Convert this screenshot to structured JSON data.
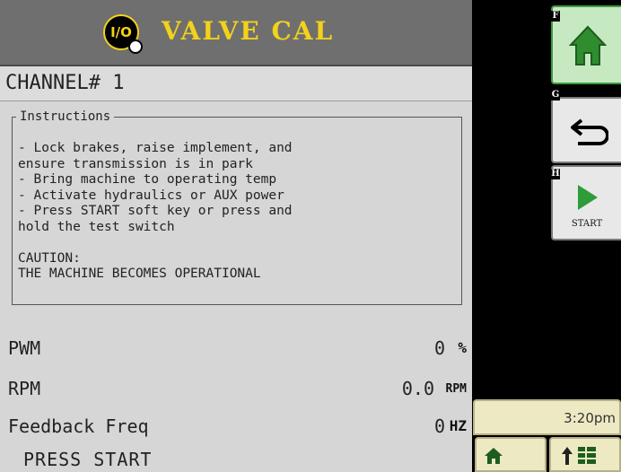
{
  "header": {
    "title": "VALVE CAL",
    "badge_text": "I/O"
  },
  "channel": {
    "label": "CHANNEL# 1"
  },
  "instructions": {
    "title": "Instructions",
    "body": "- Lock brakes, raise implement, and\nensure transmission is in park\n- Bring machine to operating temp\n- Activate hydraulics or AUX power\n- Press START soft key or press and\nhold the test switch\n\nCAUTION:\nTHE MACHINE BECOMES OPERATIONAL"
  },
  "readings": [
    {
      "label": "PWM",
      "value": "0",
      "unit": "%"
    },
    {
      "label": "RPM",
      "value": "0.0",
      "unit": "RPM"
    },
    {
      "label": "Feedback Freq",
      "value": "0",
      "unit": "HZ"
    }
  ],
  "status": {
    "text": "PRESS START"
  },
  "soft_keys": [
    {
      "letter": "F",
      "icon": "home-icon"
    },
    {
      "letter": "G",
      "icon": "back-arrow-icon"
    },
    {
      "letter": "H",
      "icon": "play-icon",
      "label": "START"
    }
  ],
  "clock": {
    "time": "3:20pm"
  },
  "bottom_buttons": [
    {
      "icon": "home-icon"
    },
    {
      "icon": "menu-icon"
    }
  ],
  "colors": {
    "title_yellow": "#f2d21b",
    "home_green": "#3d9a3d",
    "panel_gray": "#d6d6d6"
  }
}
